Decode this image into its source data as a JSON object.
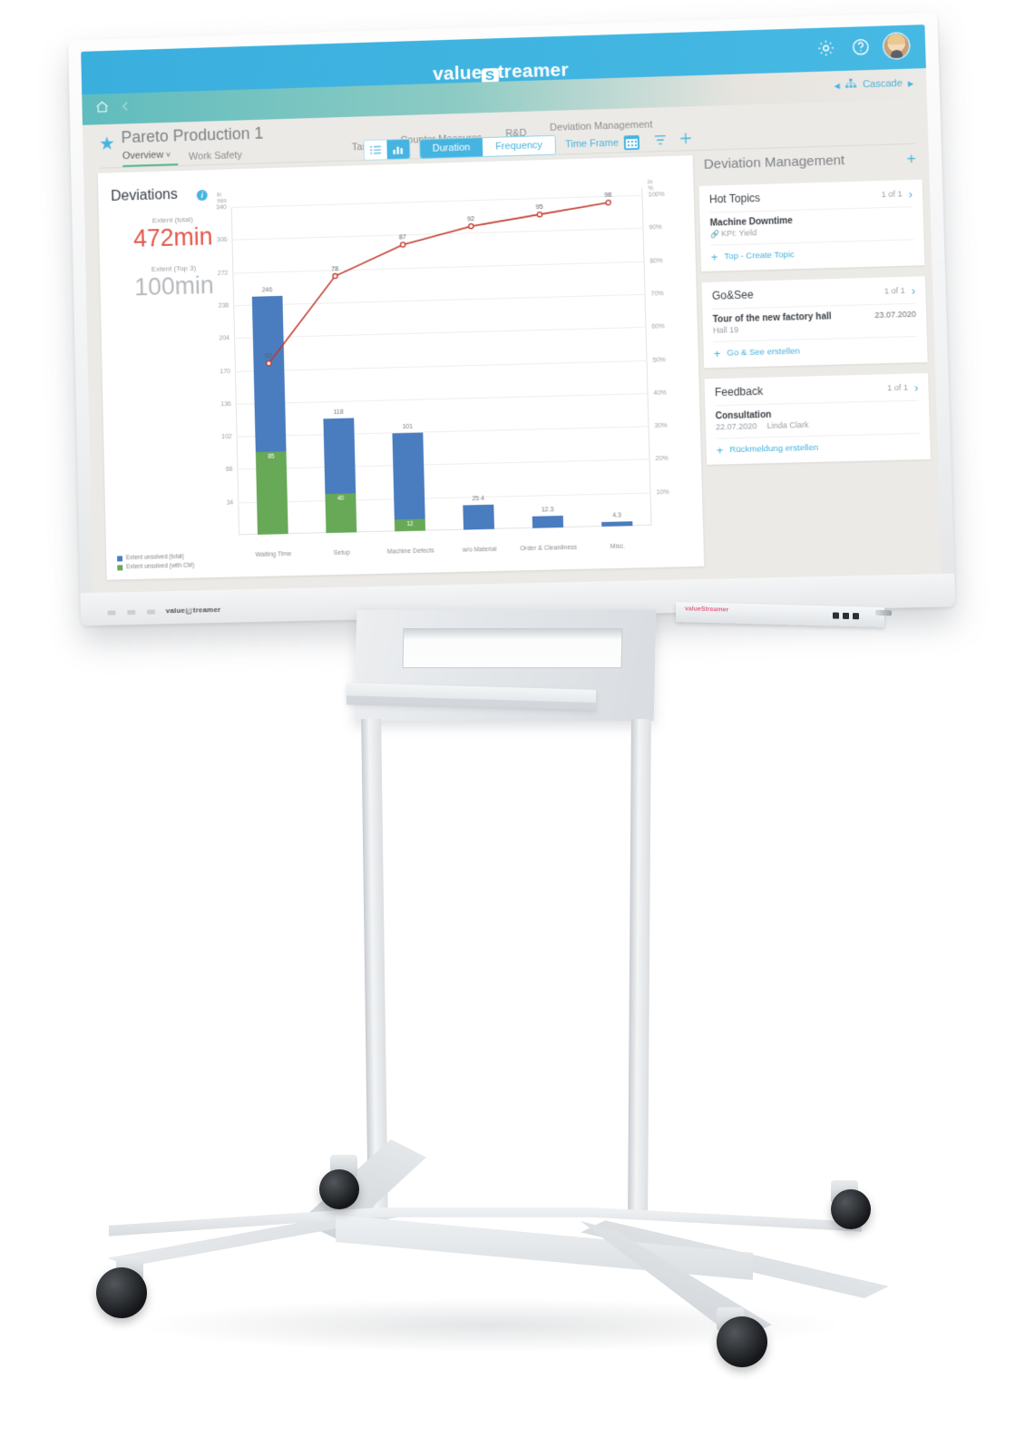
{
  "topbar": {
    "brand_prefix": "value",
    "brand_badge": "S",
    "brand_suffix": "treamer",
    "gear_icon": "gear-icon",
    "help_icon": "help-icon",
    "avatar_icon": "user-avatar"
  },
  "navbar": {
    "home_icon": "home-icon",
    "back_icon": "chevron-left-icon",
    "cascade_prev": "◀",
    "cascade_label": "Cascade",
    "cascade_next": "▶"
  },
  "page": {
    "star_icon": "★",
    "title": "Pareto Production 1",
    "tabs": [
      {
        "label": "Overview",
        "active": true,
        "caret": "˅"
      },
      {
        "label": "Work Safety",
        "active": false
      },
      {
        "label": "Tasks",
        "active": false
      },
      {
        "label": "Counter Measures",
        "active": false
      },
      {
        "label": "R&D",
        "active": false
      },
      {
        "label": "Deviation Management",
        "active": false
      }
    ]
  },
  "toolbar": {
    "list_view_icon": "list-view-icon",
    "chart_view_icon": "bar-chart-view-icon",
    "duration_label": "Duration",
    "frequency_label": "Frequency",
    "time_frame_label": "Time Frame",
    "calendar_icon": "calendar-icon",
    "filter_icon": "filter-icon",
    "add_icon": "plus-icon"
  },
  "card": {
    "title": "Deviations",
    "info_icon": "i",
    "kpis": [
      {
        "label": "Extent (total)",
        "value": "472min",
        "color": "#e2574c"
      },
      {
        "label": "Extent (Top 3)",
        "value": "100min",
        "color": "#b5b9bd"
      }
    ]
  },
  "chart_data": {
    "type": "bar",
    "title": "Deviations",
    "subtype": "pareto",
    "categories": [
      "Waiting Time",
      "Setup",
      "Machine Defects",
      "w/o Material",
      "Order & Cleanliness",
      "Misc."
    ],
    "series": [
      {
        "name": "Extent unsolved (total)",
        "color": "#4a7dbf",
        "values": [
          246,
          118,
          101,
          25.4,
          12.3,
          4.3
        ]
      },
      {
        "name": "Extent unsolved (with CM)",
        "color": "#68a957",
        "values": [
          85,
          40,
          12,
          0,
          0,
          0
        ]
      },
      {
        "name": "Cumulative %",
        "color": "#c0392b",
        "values": [
          52,
          78,
          87,
          92,
          95,
          98
        ]
      }
    ],
    "xlabel": "",
    "ylabel": "in min",
    "y2label": "in %",
    "ylim": [
      0,
      340
    ],
    "y2lim": [
      0,
      100
    ],
    "yticks": [
      34,
      68,
      102,
      136,
      170,
      204,
      238,
      272,
      306,
      340
    ],
    "y2ticks": [
      "10%",
      "20%",
      "30%",
      "40%",
      "50%",
      "60%",
      "70%",
      "80%",
      "90%",
      "100%"
    ],
    "grid": true,
    "legend": [
      "Extent unsolved (total)",
      "Extent unsolved (with CM)"
    ],
    "legend_position": "bottom-left"
  },
  "deviation_panel": {
    "title": "Deviation Management",
    "add_icon": "plus-icon",
    "cards": [
      {
        "title": "Hot Topics",
        "counter": "1 of 1",
        "chevron": "›",
        "item_title": "Machine Downtime",
        "item_sub": "KPI: Yield",
        "item_sub_icon": "link-icon",
        "item_date": "",
        "add_label": "Top - Create Topic"
      },
      {
        "title": "Go&See",
        "counter": "1 of 1",
        "chevron": "›",
        "item_title": "Tour of the new factory hall",
        "item_sub": "Hall 19",
        "item_sub_icon": "",
        "item_date": "23.07.2020",
        "add_label": "Go & See erstellen"
      },
      {
        "title": "Feedback",
        "counter": "1 of 1",
        "chevron": "›",
        "item_title": "Consultation",
        "item_sub": "22.07.2020",
        "item_sub_extra": "Linda Clark",
        "item_sub_icon": "",
        "item_date": "",
        "add_label": "Rückmeldung erstellen"
      }
    ]
  },
  "hardware": {
    "bezel_logo_prefix": "value",
    "bezel_logo_badge": "S",
    "bezel_logo_suffix": "treamer",
    "tray_logo": "valueStreamer"
  },
  "colors": {
    "accent": "#45b4e0",
    "teal": "#63bdbe",
    "bar_total": "#4a7dbf",
    "bar_cm": "#68a957",
    "line": "#c0392b",
    "red_kpi": "#e2574c"
  }
}
